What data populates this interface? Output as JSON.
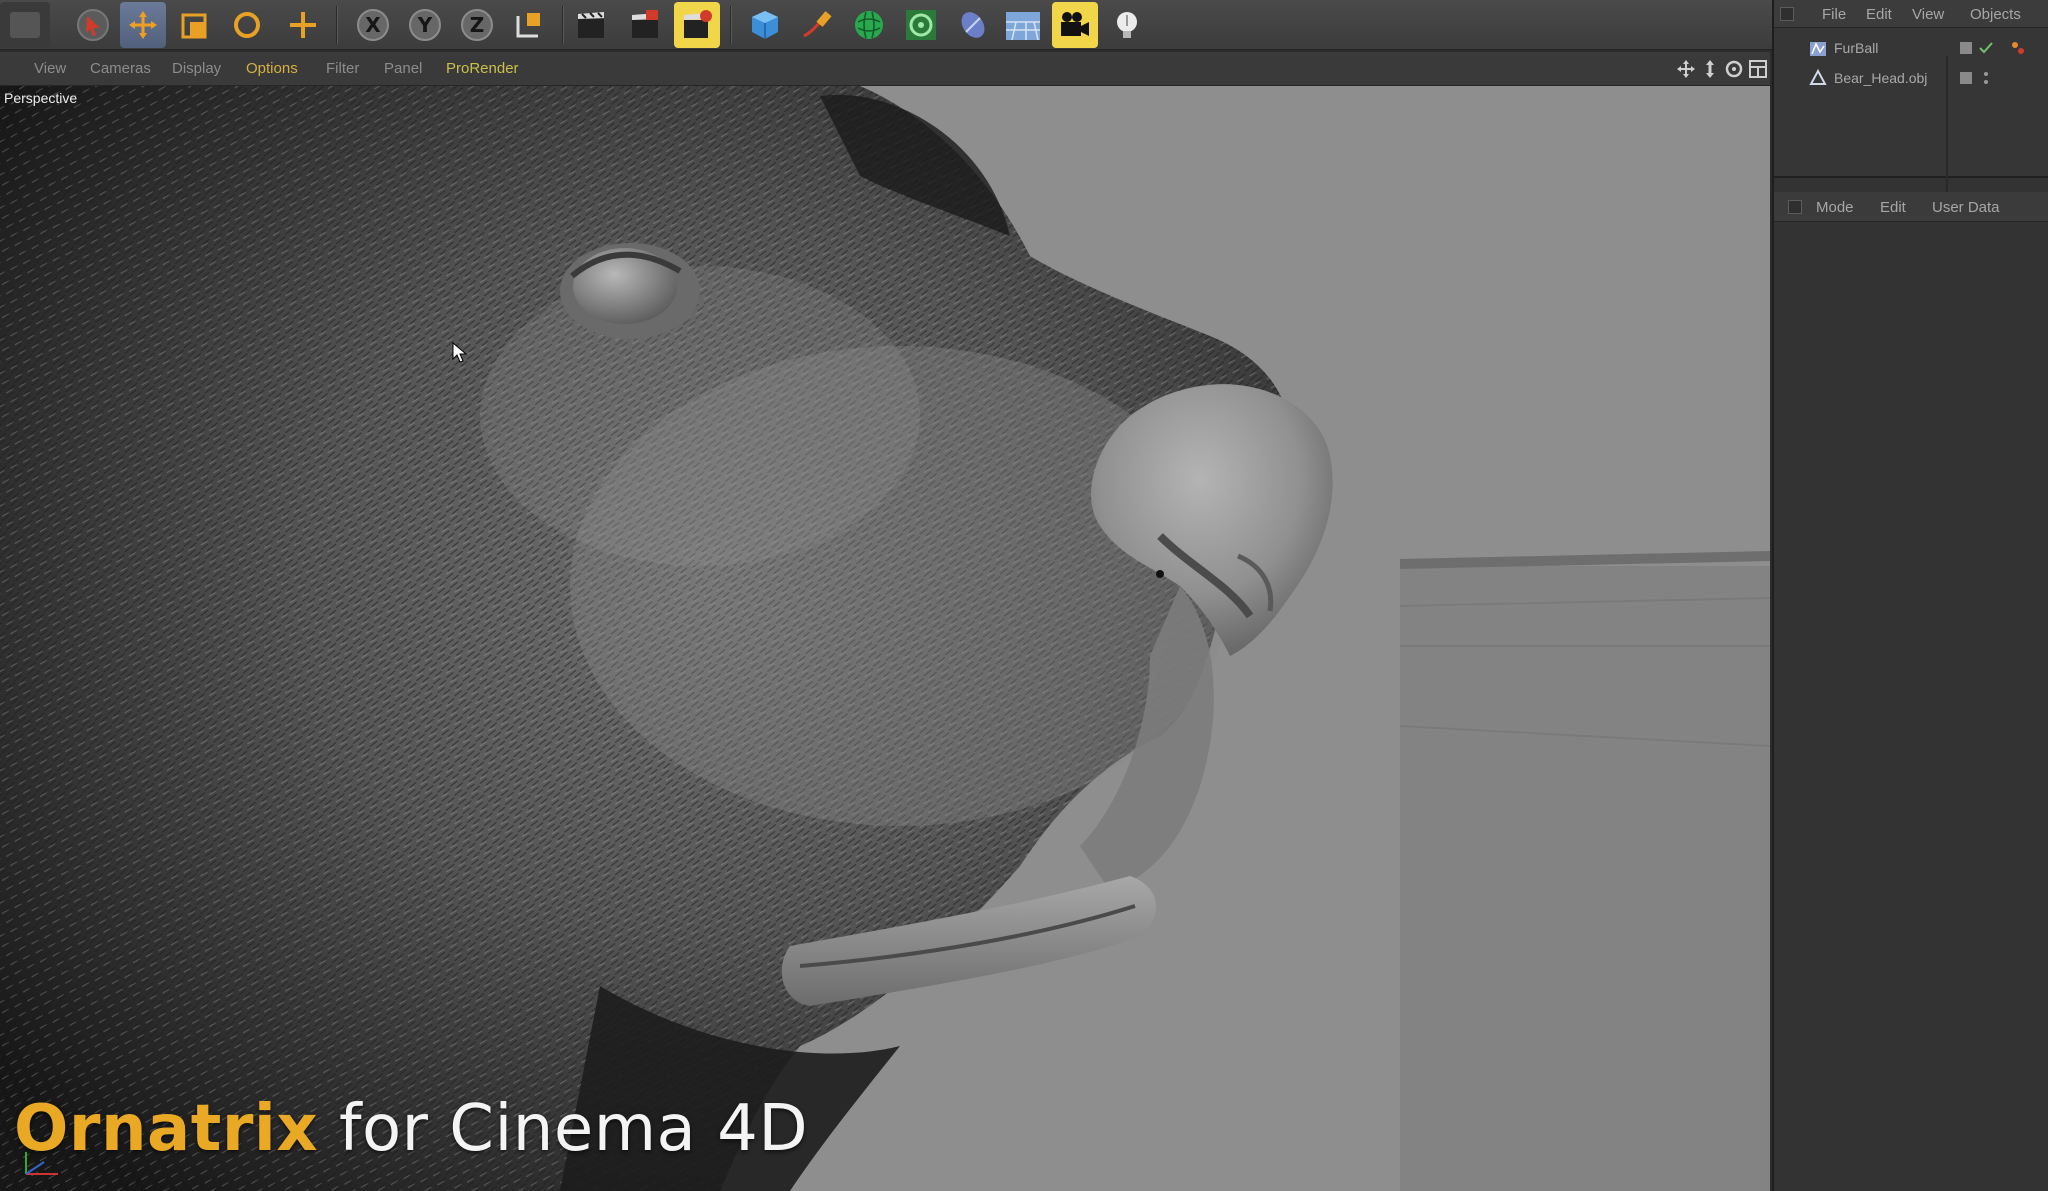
{
  "toolbar": {
    "tools": [
      {
        "icon": "undo-view-icon"
      },
      {
        "icon": "select-arrow-icon"
      },
      {
        "icon": "move-icon"
      },
      {
        "icon": "scale-icon"
      },
      {
        "icon": "rotate-icon"
      },
      {
        "icon": "add-object-icon"
      },
      {
        "icon": "x-axis-lock-icon",
        "label": "X"
      },
      {
        "icon": "y-axis-lock-icon",
        "label": "Y"
      },
      {
        "icon": "z-axis-lock-icon",
        "label": "Z"
      },
      {
        "icon": "coordinate-system-icon"
      },
      {
        "icon": "render-view-icon"
      },
      {
        "icon": "render-to-picture-viewer-icon"
      },
      {
        "icon": "render-settings-icon"
      },
      {
        "icon": "cube-primitive-icon"
      },
      {
        "icon": "pen-spline-icon"
      },
      {
        "icon": "subdivision-surface-icon"
      },
      {
        "icon": "array-generator-icon"
      },
      {
        "icon": "deformer-icon"
      },
      {
        "icon": "floor-environment-icon"
      },
      {
        "icon": "camera-icon"
      },
      {
        "icon": "light-icon"
      }
    ]
  },
  "viewport_menu": {
    "items": [
      "View",
      "Cameras",
      "Display",
      "Options",
      "Filter",
      "Panel",
      "ProRender"
    ],
    "active": "Options",
    "nav_icons": [
      "move-view-icon",
      "zoom-view-icon",
      "rotate-view-icon",
      "toggle-layout-icon"
    ]
  },
  "viewport": {
    "label": "Perspective"
  },
  "overlay": {
    "brand": "Ornatrix",
    "rest": " for Cinema 4D",
    "brand_color": "#e9a925"
  },
  "object_manager": {
    "menu": [
      "File",
      "Edit",
      "View",
      "Objects"
    ],
    "objects": [
      {
        "name": "FurBall",
        "icon": "furball-icon"
      },
      {
        "name": "Bear_Head.obj",
        "icon": "polygon-object-icon"
      }
    ]
  },
  "attribute_manager": {
    "menu": [
      "Mode",
      "Edit",
      "User Data"
    ]
  },
  "colors": {
    "toolbar_bg": "#404040",
    "viewport_bg": "#8f8f8f",
    "panel_bg": "#333333",
    "active_menu": "#d7b040",
    "highlight_tool": "#f2d64a"
  }
}
